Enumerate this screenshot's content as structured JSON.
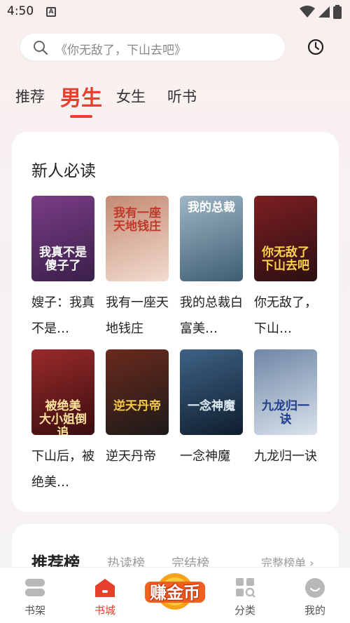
{
  "status": {
    "time": "4:50",
    "a_icon": "A"
  },
  "search": {
    "placeholder": "《你无敌了，下山去吧》"
  },
  "tabs": [
    {
      "label": "推荐"
    },
    {
      "label": "男生"
    },
    {
      "label": "女生"
    },
    {
      "label": "听书"
    }
  ],
  "section": {
    "title": "新人必读",
    "books": [
      {
        "title": "嫂子：我真不是…",
        "cover_text": "我真不是\n傻子了",
        "colors": [
          "#3a1f4a",
          "#7a3d86"
        ]
      },
      {
        "title": "我有一座天地钱庄",
        "cover_text": "我有一座\n天地钱庄",
        "colors": [
          "#f2dcd0",
          "#c38a72"
        ]
      },
      {
        "title": "我的总裁白富美…",
        "cover_text": "我的总裁",
        "colors": [
          "#3e5e73",
          "#9fb6c4"
        ]
      },
      {
        "title": "你无敌了，下山…",
        "cover_text": "你无敌了\n下山去吧",
        "colors": [
          "#2b0f12",
          "#7d1f22"
        ]
      },
      {
        "title": "下山后，被绝美…",
        "cover_text": "被绝美\n大小姐倒追",
        "colors": [
          "#3a0e10",
          "#9a2a2a"
        ]
      },
      {
        "title": "逆天丹帝",
        "cover_text": "逆天丹帝",
        "colors": [
          "#1d1a1a",
          "#6a2a1c"
        ]
      },
      {
        "title": "一念神魔",
        "cover_text": "一念神魔",
        "colors": [
          "#0f1e2e",
          "#3e6285"
        ]
      },
      {
        "title": "九龙归一诀",
        "cover_text": "九龙归一诀",
        "colors": [
          "#d9e3ec",
          "#6f86a6"
        ]
      }
    ]
  },
  "ranking": {
    "title": "推荐榜",
    "tabs": [
      "热读榜",
      "完结榜"
    ],
    "more": "完整榜单 ›"
  },
  "nav": {
    "items": [
      {
        "label": "书架",
        "icon": "bookshelf-icon"
      },
      {
        "label": "书城",
        "icon": "bookstore-icon"
      },
      {
        "label": "分类",
        "icon": "category-icon"
      },
      {
        "label": "我的",
        "icon": "profile-icon"
      }
    ],
    "earn": "赚金币"
  },
  "colors": {
    "accent": "#e8402c"
  }
}
